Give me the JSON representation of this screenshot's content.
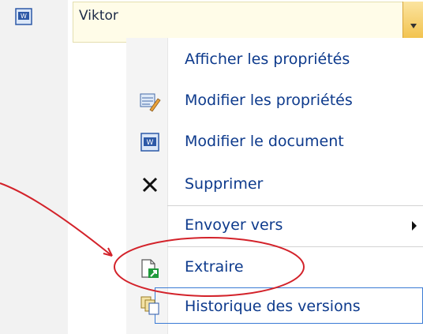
{
  "header": {
    "document_icon": "word-document-icon",
    "name_value": "Viktor",
    "dropdown_icon": "chevron-down-icon"
  },
  "menu": {
    "items": [
      {
        "label": "Afficher les propriétés",
        "icon": ""
      },
      {
        "label": "Modifier les propriétés",
        "icon": "edit-properties-icon"
      },
      {
        "label": "Modifier le document",
        "icon": "word-document-icon"
      },
      {
        "label": "Supprimer",
        "icon": "delete-x-icon"
      },
      {
        "label": "Envoyer vers",
        "icon": "",
        "has_submenu": true
      },
      {
        "label": "Extraire",
        "icon": "checkout-icon"
      },
      {
        "label": "Historique des versions",
        "icon": "version-history-icon"
      }
    ]
  },
  "annotation": {
    "color": "#d3222a",
    "shape": "ellipse-with-arrow",
    "target": "Extraire"
  }
}
